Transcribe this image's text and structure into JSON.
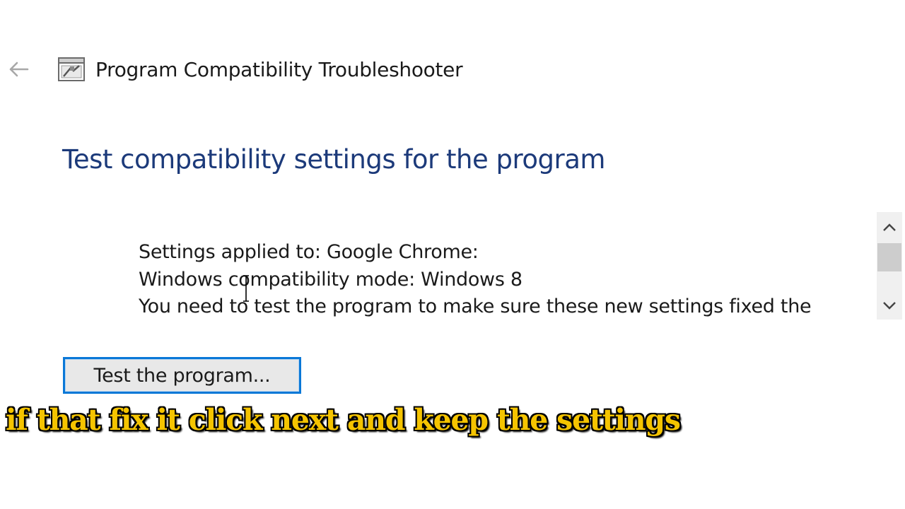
{
  "header": {
    "back_icon": "back-arrow-icon",
    "app_icon": "troubleshooter-app-icon",
    "title": "Program Compatibility Troubleshooter"
  },
  "main": {
    "heading": "Test compatibility settings for the program",
    "settings_lines": [
      "Settings applied to: Google Chrome:",
      "Windows compatibility mode: Windows 8",
      "You need to test the program to make sure these new settings fixed the"
    ],
    "test_button_label": "Test the program..."
  },
  "scrollbar": {
    "up_icon": "chevron-up-icon",
    "down_icon": "chevron-down-icon"
  },
  "caption": {
    "text": "if that fix it click next and keep the settings",
    "color": "#f5c400"
  },
  "colors": {
    "heading": "#1c3a7a",
    "button_border": "#0a78d7"
  }
}
